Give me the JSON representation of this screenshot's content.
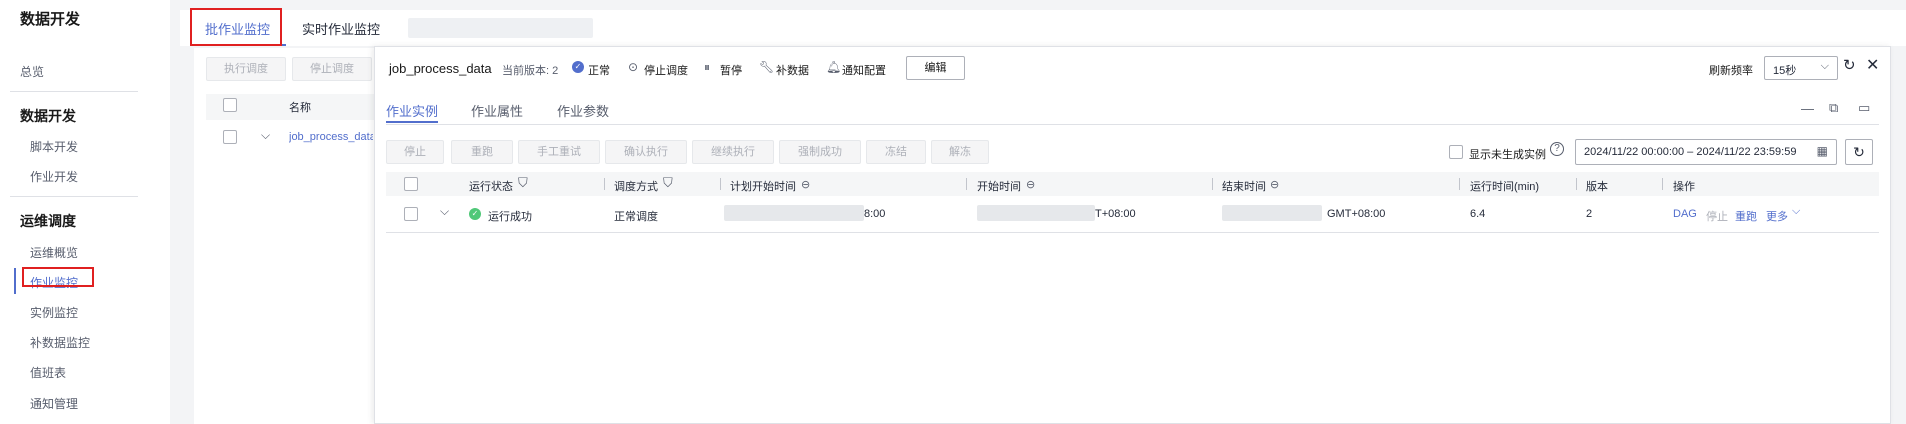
{
  "sidebar": {
    "title": "数据开发",
    "overview": "总览",
    "section1": "数据开发",
    "section1_items": [
      "脚本开发",
      "作业开发"
    ],
    "section2": "运维调度",
    "section2_items": [
      "运维概览",
      "作业监控",
      "实例监控",
      "补数据监控",
      "值班表",
      "通知管理"
    ],
    "active_item": "作业监控"
  },
  "top_tabs": [
    "批作业监控",
    "实时作业监控"
  ],
  "left_panel": {
    "buttons": [
      "执行调度",
      "停止调度"
    ],
    "header_name": "名称",
    "row_name": "job_process_data"
  },
  "detail": {
    "job_name": "job_process_data",
    "version_label": "当前版本: 2",
    "status": "正常",
    "actions": [
      "停止调度",
      "暂停",
      "补数据",
      "通知配置"
    ],
    "edit_label": "编辑",
    "refresh_label": "刷新频率",
    "refresh_value": "15秒",
    "tabs": [
      "作业实例",
      "作业属性",
      "作业参数"
    ],
    "toolbar": [
      "停止",
      "重跑",
      "手工重试",
      "确认执行",
      "继续执行",
      "强制成功",
      "冻结",
      "解冻"
    ],
    "show_ungenerated": "显示未生成实例",
    "date_range": "2024/11/22 00:00:00 – 2024/11/22 23:59:59",
    "columns": [
      "运行状态",
      "调度方式",
      "计划开始时间",
      "开始时间",
      "结束时间",
      "运行时间(min)",
      "版本",
      "操作"
    ],
    "row": {
      "status": "运行成功",
      "schedule": "正常调度",
      "plan_start_suffix": "8:00",
      "start_suffix": "T+08:00",
      "end_suffix": "GMT+08:00",
      "runtime": "6.4",
      "version": "2",
      "ops": [
        "DAG",
        "停止",
        "重跑",
        "更多"
      ]
    }
  },
  "colors": {
    "accent": "#526ecc",
    "success": "#50c878",
    "highlight": "#e02020"
  }
}
